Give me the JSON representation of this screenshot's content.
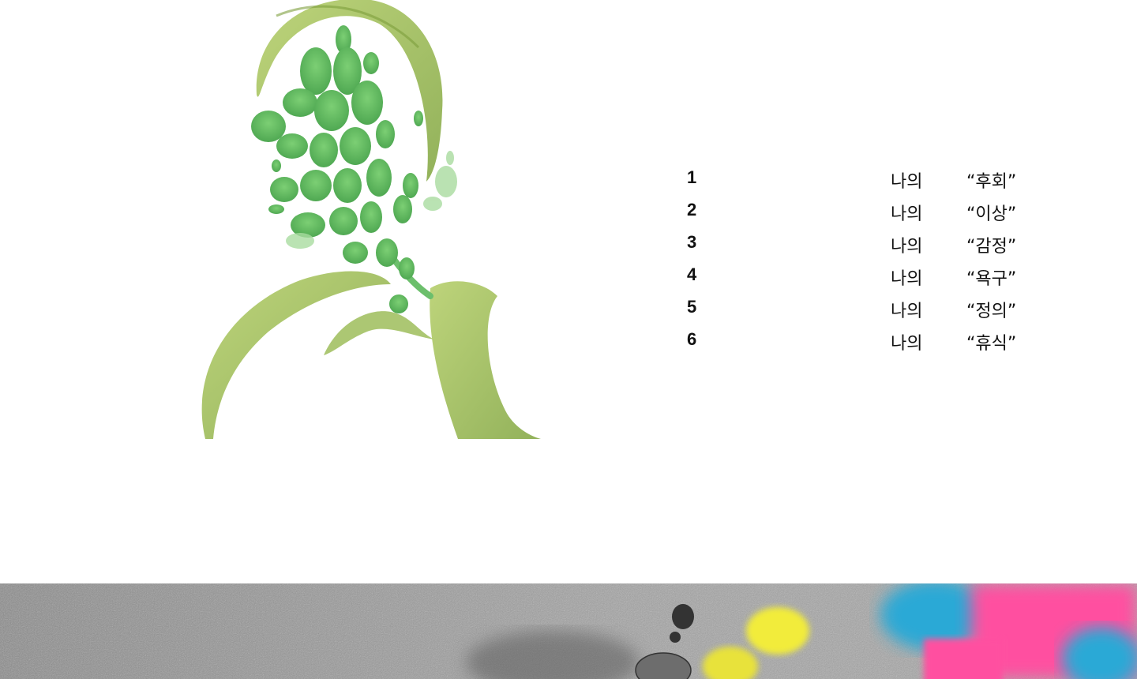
{
  "chapters": [
    {
      "number": "1",
      "prefix": "나의",
      "title": "“후회”"
    },
    {
      "number": "2",
      "prefix": "나의",
      "title": "“이상”"
    },
    {
      "number": "3",
      "prefix": "나의",
      "title": "“감정”"
    },
    {
      "number": "4",
      "prefix": "나의",
      "title": "“욕구”"
    },
    {
      "number": "5",
      "prefix": "나의",
      "title": "“정의”"
    },
    {
      "number": "6",
      "prefix": "나의",
      "title": "“휴식”"
    }
  ],
  "colors": {
    "leaf_green": "#9dbd5a",
    "bud_green": "#6cbf6c",
    "text": "#111111",
    "band_gray": "#9a9a9a",
    "accent_yellow": "#f2ec3a",
    "accent_cyan": "#2aa9d6",
    "accent_pink": "#ff4fa0"
  },
  "icons": {
    "illustration": "green-plant-illustration",
    "band": "abstract-noise-artwork"
  }
}
